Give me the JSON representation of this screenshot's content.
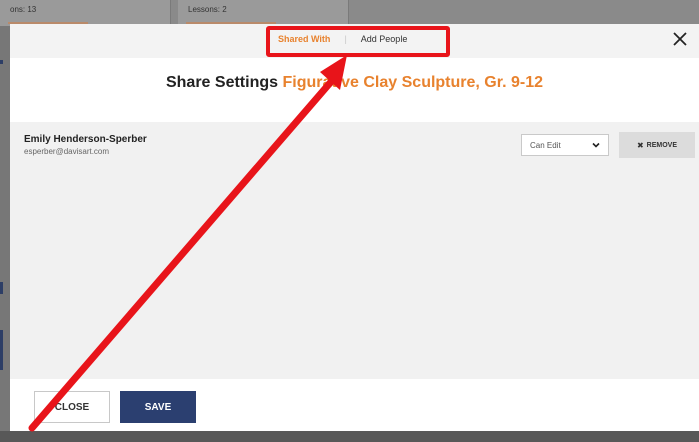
{
  "background": {
    "cards": [
      {
        "text": "ons: 13"
      },
      {
        "text": "Lessons: 2"
      }
    ]
  },
  "modal": {
    "tabs": {
      "shared_with": "Shared With",
      "separator": "|",
      "add_people": "Add People"
    },
    "close_icon": "close-icon",
    "title": {
      "prefix": "Share Settings",
      "name": "Figurative Clay Sculpture, Gr. 9-12"
    },
    "shared_users": [
      {
        "name": "Emily Henderson-Sperber",
        "email": "esperber@davisart.com",
        "permission": "Can Edit",
        "remove_label": "REMOVE"
      }
    ],
    "footer": {
      "close_label": "CLOSE",
      "save_label": "SAVE"
    }
  },
  "colors": {
    "accent_orange": "#e8822e",
    "primary_navy": "#2b3f70",
    "annotation_red": "#e8141a"
  }
}
